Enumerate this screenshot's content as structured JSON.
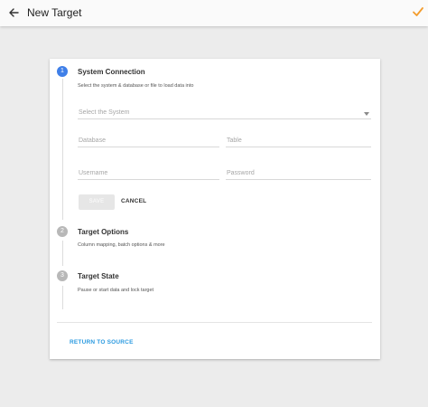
{
  "header": {
    "title": "New Target",
    "back_icon": "arrow-left-icon",
    "confirm_icon": "check-icon",
    "confirm_color": "#f39c2d"
  },
  "steps": [
    {
      "number": "1",
      "title": "System Connection",
      "subtitle": "Select the system & database or file to load data into",
      "state": "active"
    },
    {
      "number": "2",
      "title": "Target Options",
      "subtitle": "Column mapping, batch options & more",
      "state": "inactive"
    },
    {
      "number": "3",
      "title": "Target State",
      "subtitle": "Pause or start data and lock target",
      "state": "inactive"
    }
  ],
  "form": {
    "system_placeholder": "Select the System",
    "database_placeholder": "Database",
    "table_placeholder": "Table",
    "username_placeholder": "Username",
    "password_placeholder": "Password",
    "save_label": "SAVE",
    "cancel_label": "CANCEL"
  },
  "footer": {
    "return_label": "RETURN TO SOURCE"
  },
  "colors": {
    "active_step": "#3f7fe8",
    "inactive_step": "#b8b8b8",
    "link": "#2b9ae0",
    "background": "#ececec"
  }
}
